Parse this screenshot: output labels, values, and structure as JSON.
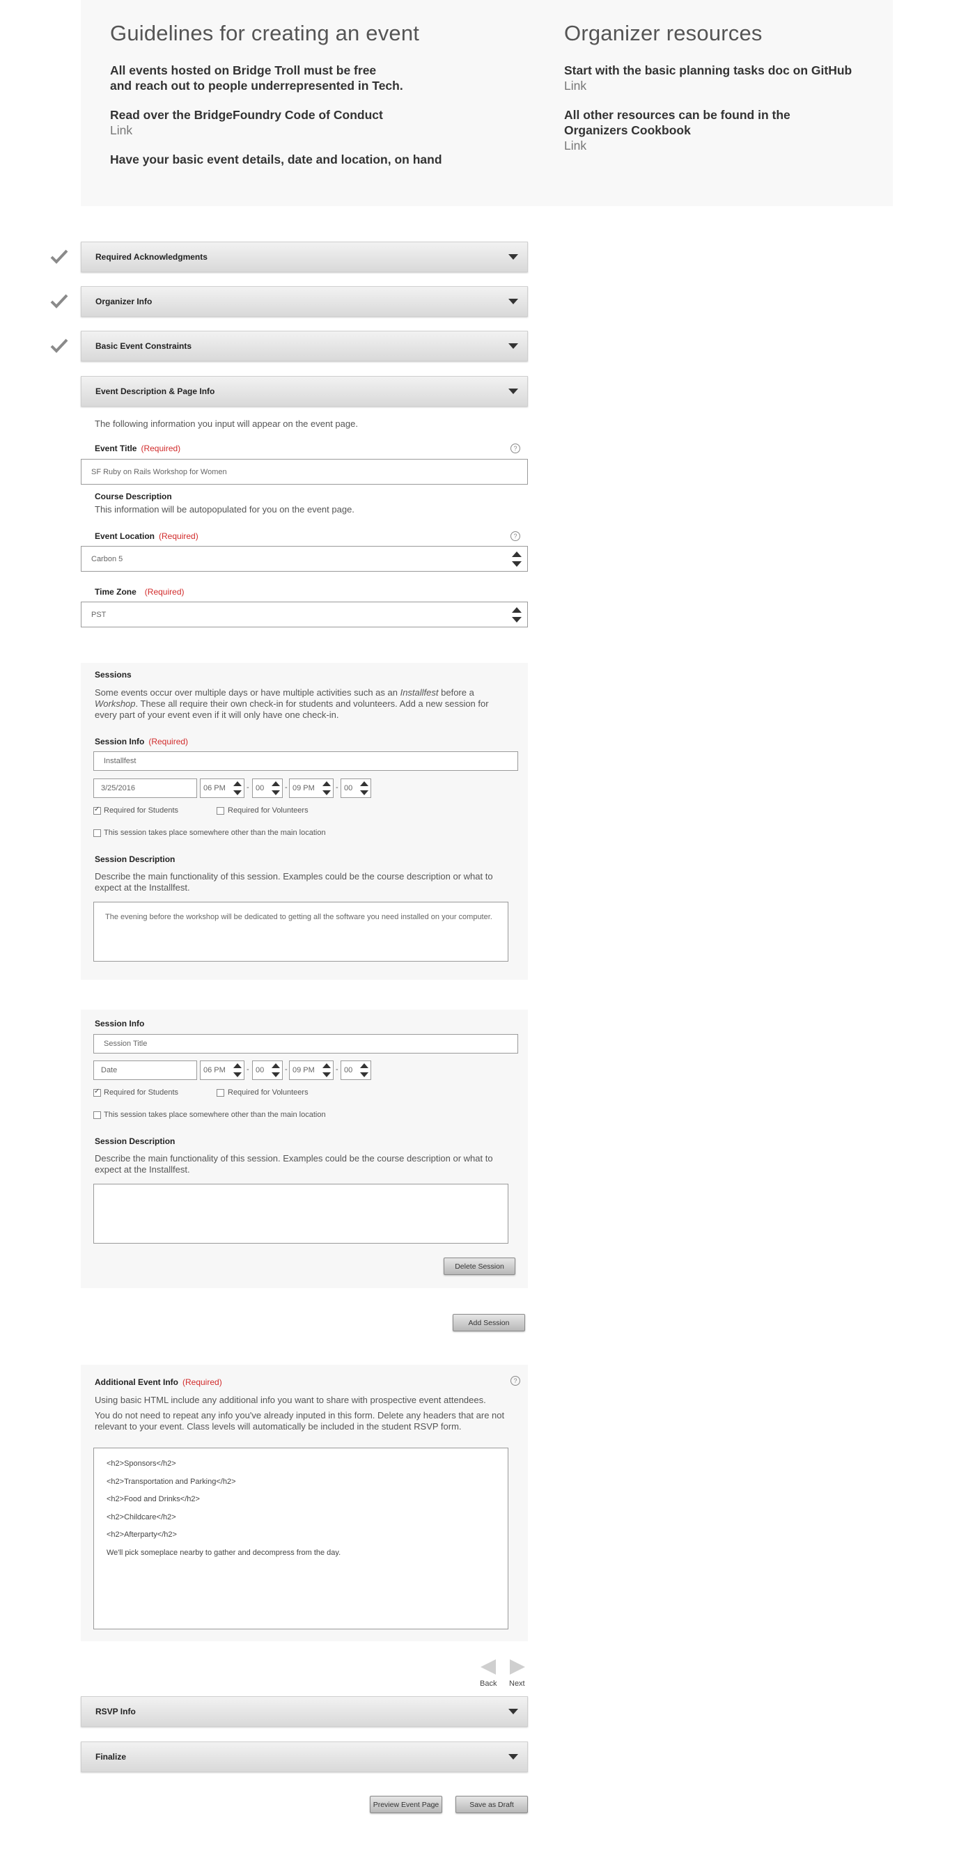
{
  "guidelines": {
    "title": "Guidelines for creating an event",
    "item1_line1": "All events hosted on Bridge Troll must be free",
    "item1_line2": "and reach out to people underrepresented in Tech.",
    "item2": "Read over the BridgeFoundry Code of Conduct",
    "item2_link": "Link",
    "item3": "Have your basic event details, date and location, on hand"
  },
  "resources": {
    "title": "Organizer resources",
    "item1": "Start with the basic planning tasks doc on GitHub",
    "item1_link": "Link",
    "item2_line1": "All other resources can be found in the",
    "item2_line2": "Organizers Cookbook",
    "item2_link": "Link"
  },
  "sections": {
    "s1": "Required Acknowledgments",
    "s2": "Organizer Info",
    "s3": "Basic Event Constraints",
    "s4": "Event Description & Page Info",
    "s5": "RSVP Info",
    "s6": "Finalize"
  },
  "event_desc": {
    "intro": "The following information you input will appear on the event page.",
    "title_label": "Event Title",
    "required": "(Required)",
    "title_value": "SF Ruby on Rails Workshop for Women",
    "course_label": "Course Description",
    "course_help": "This information will be autopopulated for you on the event page.",
    "location_label": "Event Location",
    "location_value": "Carbon 5",
    "timezone_label": "Time Zone",
    "timezone_value": "PST",
    "help_icon": "?"
  },
  "sessions": {
    "heading": "Sessions",
    "intro_a": "Some events occur over multiple days or have multiple activities such as an ",
    "intro_b": "Installfest",
    "intro_c": " before a",
    "intro_d": "Workshop",
    "intro_e": ". These all require their own check-in for students and volunteers. Add a new session for every part of your event even if it will only have one check-in.",
    "session_info_label": "Session Info",
    "required": "(Required)",
    "s1": {
      "title_value": "Installfest",
      "date_value": "3/25/2016",
      "start_hour": "06 PM",
      "start_min": "00",
      "end_hour": "09 PM",
      "end_min": "00",
      "req_students": "Required for Students",
      "req_volunteers": "Required for Volunteers",
      "other_location": "This session takes place somewhere other than the main location",
      "desc_label": "Session Description",
      "desc_help": "Describe the main functionality of this session. Examples could be the course description or what to expect at the Installfest.",
      "desc_value": "The evening before the workshop will be dedicated to getting all the software you need installed on your computer."
    },
    "s2": {
      "title_placeholder": "Session Title",
      "date_placeholder": "Date",
      "start_hour": "06 PM",
      "start_min": "00",
      "end_hour": "09 PM",
      "end_min": "00",
      "req_students": "Required for Students",
      "req_volunteers": "Required for Volunteers",
      "other_location": "This session takes place somewhere other than the main location",
      "desc_label": "Session Description",
      "desc_help": "Describe the main functionality of this session. Examples could be the course description or what to expect at the Installfest.",
      "delete_button": "Delete Session"
    },
    "time_sep": "-",
    "add_button": "Add Session"
  },
  "additional": {
    "label": "Additional Event Info",
    "required": "(Required)",
    "help1": "Using basic HTML include any additional info you want to share with prospective event attendees.",
    "help2": "You do not need to repeat any info you've already inputed in this form. Delete any headers that are not relevant to your event. Class levels will automatically be included in the student RSVP form.",
    "lines": [
      "<h2>Sponsors</h2>",
      "<h2>Transportation and Parking</h2>",
      "<h2>Food and Drinks</h2>",
      "<h2>Childcare</h2>",
      "<h2>Afterparty</h2>",
      "We'll pick someplace nearby to gather and decompress from the day."
    ]
  },
  "nav": {
    "back": "Back",
    "next": "Next"
  },
  "footer": {
    "preview": "Preview Event Page",
    "save": "Save as Draft"
  },
  "colors": {
    "required": "#d12b2b",
    "panel": "#f7f7f7",
    "checkmark": "#8a8a8a"
  }
}
